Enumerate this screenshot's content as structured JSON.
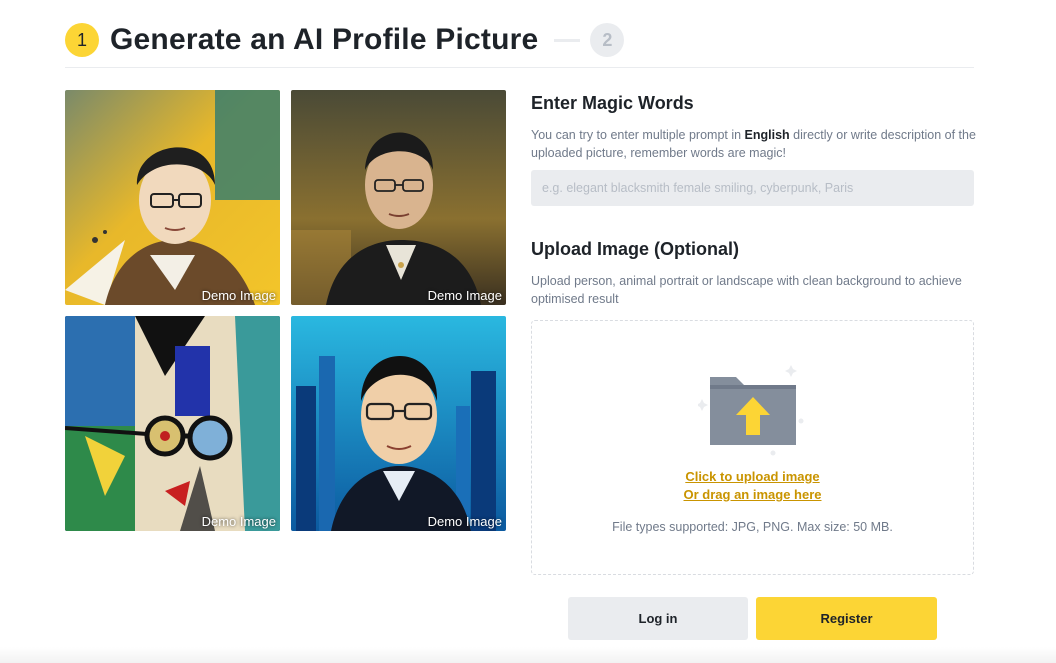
{
  "stepper": {
    "step1_number": "1",
    "title": "Generate an AI Profile Picture",
    "step2_number": "2"
  },
  "demo_images": [
    {
      "label": "Demo Image",
      "style": "sketch-portrait-yellow"
    },
    {
      "label": "Demo Image",
      "style": "oil-portrait-dark"
    },
    {
      "label": "Demo Image",
      "style": "cubist-portrait"
    },
    {
      "label": "Demo Image",
      "style": "cyberpunk-portrait-blue"
    }
  ],
  "magic_words": {
    "title": "Enter Magic Words",
    "desc_before": "You can try to enter multiple prompt in ",
    "desc_bold": "English",
    "desc_after": " directly or write description of the uploaded picture, remember words are magic!",
    "placeholder": "e.g. elegant blacksmith female smiling, cyberpunk, Paris",
    "value": ""
  },
  "upload": {
    "title": "Upload Image (Optional)",
    "desc": "Upload person, animal portrait or landscape with clean background to achieve optimised result",
    "click_link": "Click to upload image",
    "drag_link": "Or drag an image here",
    "file_types": "File types supported: JPG, PNG. Max size: 50 MB.",
    "icon": "folder-upload-icon"
  },
  "buttons": {
    "login": "Log in",
    "register": "Register"
  },
  "colors": {
    "accent": "#fcd535",
    "link": "#c99400",
    "muted_bg": "#eaecef",
    "text": "#1e2329",
    "muted_text": "#707a8a"
  }
}
